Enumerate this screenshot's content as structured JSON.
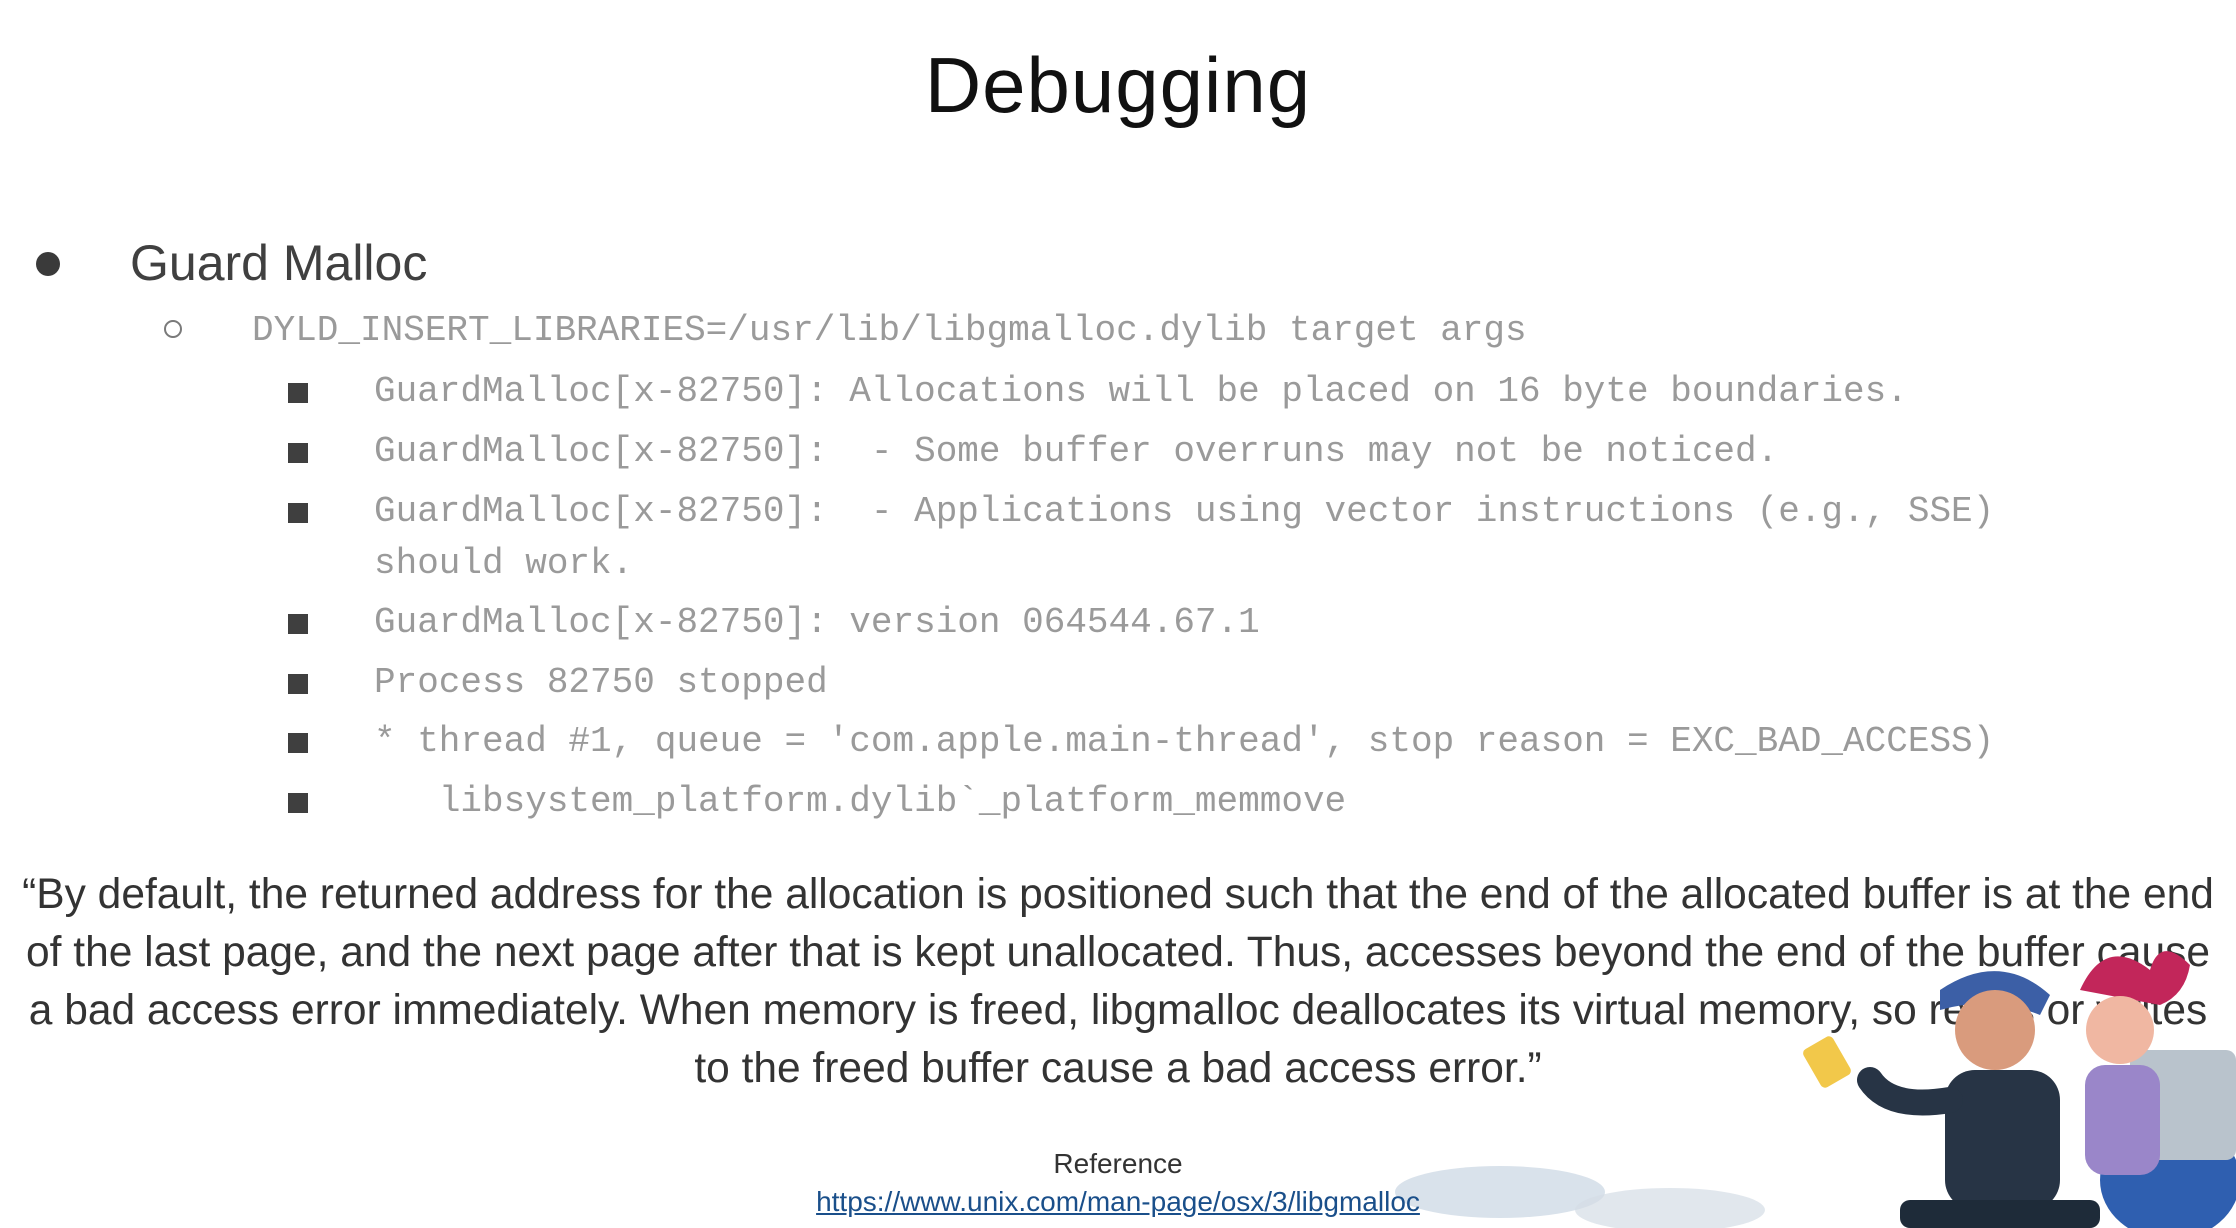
{
  "slide": {
    "title": "Debugging",
    "bullet": "Guard Malloc",
    "command": "DYLD_INSERT_LIBRARIES=/usr/lib/libgmalloc.dylib target args",
    "output_lines": [
      "GuardMalloc[x-82750]: Allocations will be placed on 16 byte boundaries.",
      "GuardMalloc[x-82750]:  - Some buffer overruns may not be noticed.",
      "GuardMalloc[x-82750]:  - Applications using vector instructions (e.g., SSE)\nshould work.",
      "GuardMalloc[x-82750]: version 064544.67.1",
      "Process 82750 stopped",
      "* thread #1, queue = 'com.apple.main-thread', stop reason = EXC_BAD_ACCESS)",
      "   libsystem_platform.dylib`_platform_memmove"
    ],
    "quote": "“By default, the returned address for the allocation is positioned such that the end of the allocated buffer is at the end of the last page, and the next page after that is kept unallocated. Thus, accesses beyond the end of the buffer cause a bad access error immediately.  When memory is freed, libgmalloc deallocates its virtual memory, so reads or writes to the freed buffer cause a bad access error.”",
    "reference_label": "Reference",
    "reference_link": "https://www.unix.com/man-page/osx/3/libgmalloc"
  },
  "colors": {
    "title": "#111111",
    "code_text": "#9a9a9a",
    "link": "#1a4f8a"
  }
}
